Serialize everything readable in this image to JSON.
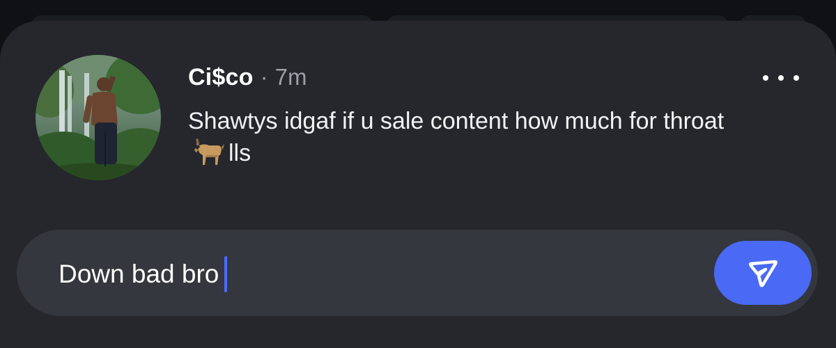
{
  "comment": {
    "author": "Ci$co",
    "separator": "·",
    "time": "7m",
    "text_before_emoji": "Shawtys idgaf if u sale content how much for throat",
    "emoji": "goat-emoji",
    "text_after_emoji": "lls"
  },
  "composer": {
    "value": "Down bad bro",
    "send_icon": "send-icon"
  },
  "menu": {
    "icon": "more-horizontal-icon"
  },
  "colors": {
    "sheet": "#25272d",
    "composer": "#34373e",
    "accent": "#4a69f5",
    "muted_text": "#9c9fa6"
  }
}
